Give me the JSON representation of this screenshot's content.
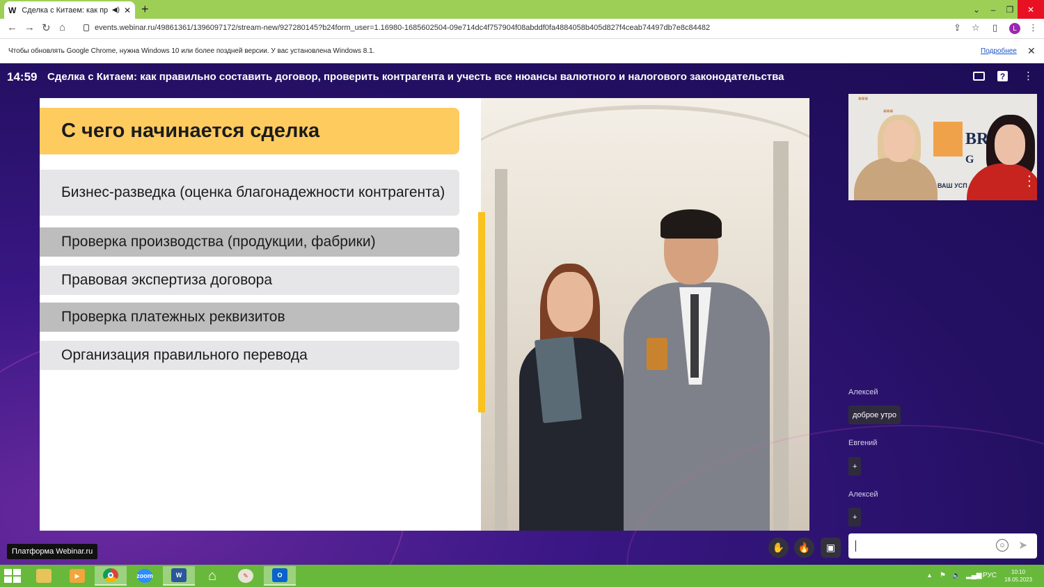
{
  "browser": {
    "tab_title": "Сделка с Китаем: как прави",
    "tab_favicon": "W",
    "url": "events.webinar.ru/49861361/1396097172/stream-new/927280145?b24form_user=1.16980-1685602504-09e714dc4f757904f08abddf0fa4884058b405d827f4ceab74497db7e8c84482",
    "profile_letter": "L",
    "tab_bar_color": "#9dcf57"
  },
  "infobar": {
    "message": "Чтобы обновлять Google Chrome, нужна Windows 10 или более поздней версии. У вас установлена Windows 8.1.",
    "link": "Подробнее"
  },
  "webinar": {
    "time": "14:59",
    "title": "Сделка с Китаем: как правильно составить договор, проверить контрагента и учесть все нюансы валютного и налогового законодательства",
    "platform_label": "Платформа Webinar.ru"
  },
  "slide": {
    "title": "С чего начинается сделка",
    "items": [
      "Бизнес-разведка (оценка благонадежности контрагента)",
      "Проверка производства (продукции, фабрики)",
      "Правовая экспертиза договора",
      "Проверка платежных реквизитов",
      "Организация правильного перевода"
    ],
    "accent_color": "#fecb5f"
  },
  "video": {
    "brand_text": "BR",
    "brand_text_2": "G",
    "brand_sub": "ВАШ УСП"
  },
  "chat": {
    "messages": [
      {
        "author": "Алексей",
        "text": "доброе утро"
      },
      {
        "author": "Евгений",
        "text": "+"
      },
      {
        "author": "Алексей",
        "text": "+"
      }
    ]
  },
  "controls": {
    "hand_icon": "raise-hand-icon",
    "fire_icon": "reaction-icon",
    "pip_icon": "picture-in-picture-icon"
  },
  "taskbar": {
    "apps": [
      "explorer",
      "media",
      "chrome",
      "zoom",
      "word",
      "home",
      "paint",
      "outlook"
    ],
    "zoom_label": "zoom",
    "word_label": "W",
    "outlook_label": "O",
    "language": "РУС",
    "time": "10:10",
    "date": "18.05.2023"
  }
}
